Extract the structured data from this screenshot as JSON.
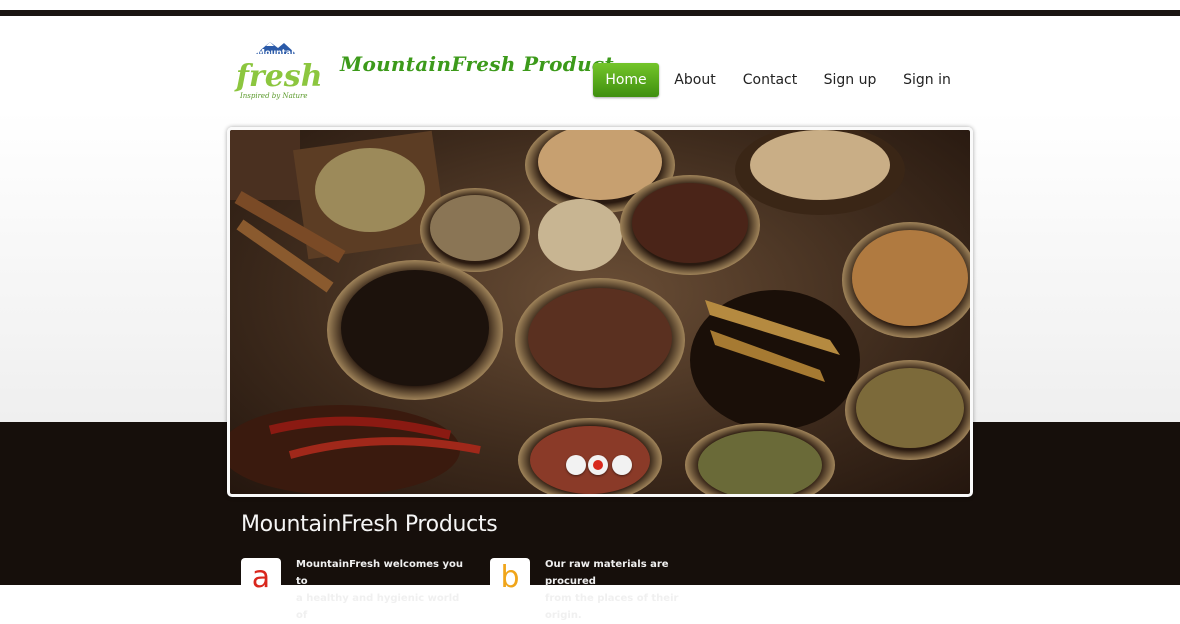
{
  "brand": {
    "logo_top": "Mountain",
    "logo_main": "fresh",
    "logo_tagline": "Inspired by Nature",
    "title": "MountainFresh Product"
  },
  "nav": {
    "items": [
      {
        "label": "Home",
        "active": true
      },
      {
        "label": "About",
        "active": false
      },
      {
        "label": "Contact",
        "active": false
      },
      {
        "label": "Sign up",
        "active": false
      },
      {
        "label": "Sign in",
        "active": false
      }
    ]
  },
  "slider": {
    "image": "spices-bowls-photo",
    "slides_count": 3,
    "active_slide": 2
  },
  "section": {
    "title": "MountainFresh Products"
  },
  "features": [
    {
      "icon_letter": "a",
      "icon_color": "#d9261c",
      "line1": "MountainFresh welcomes you to",
      "line2": "a healthy and hygienic world of"
    },
    {
      "icon_letter": "b",
      "icon_color": "#f0a51a",
      "line1": "Our raw materials are procured",
      "line2": "from the places of their origin."
    }
  ],
  "colors": {
    "accent_green": "#3f8f0f",
    "brand_green": "#3c9a1a",
    "dark_band": "#160f0b"
  }
}
